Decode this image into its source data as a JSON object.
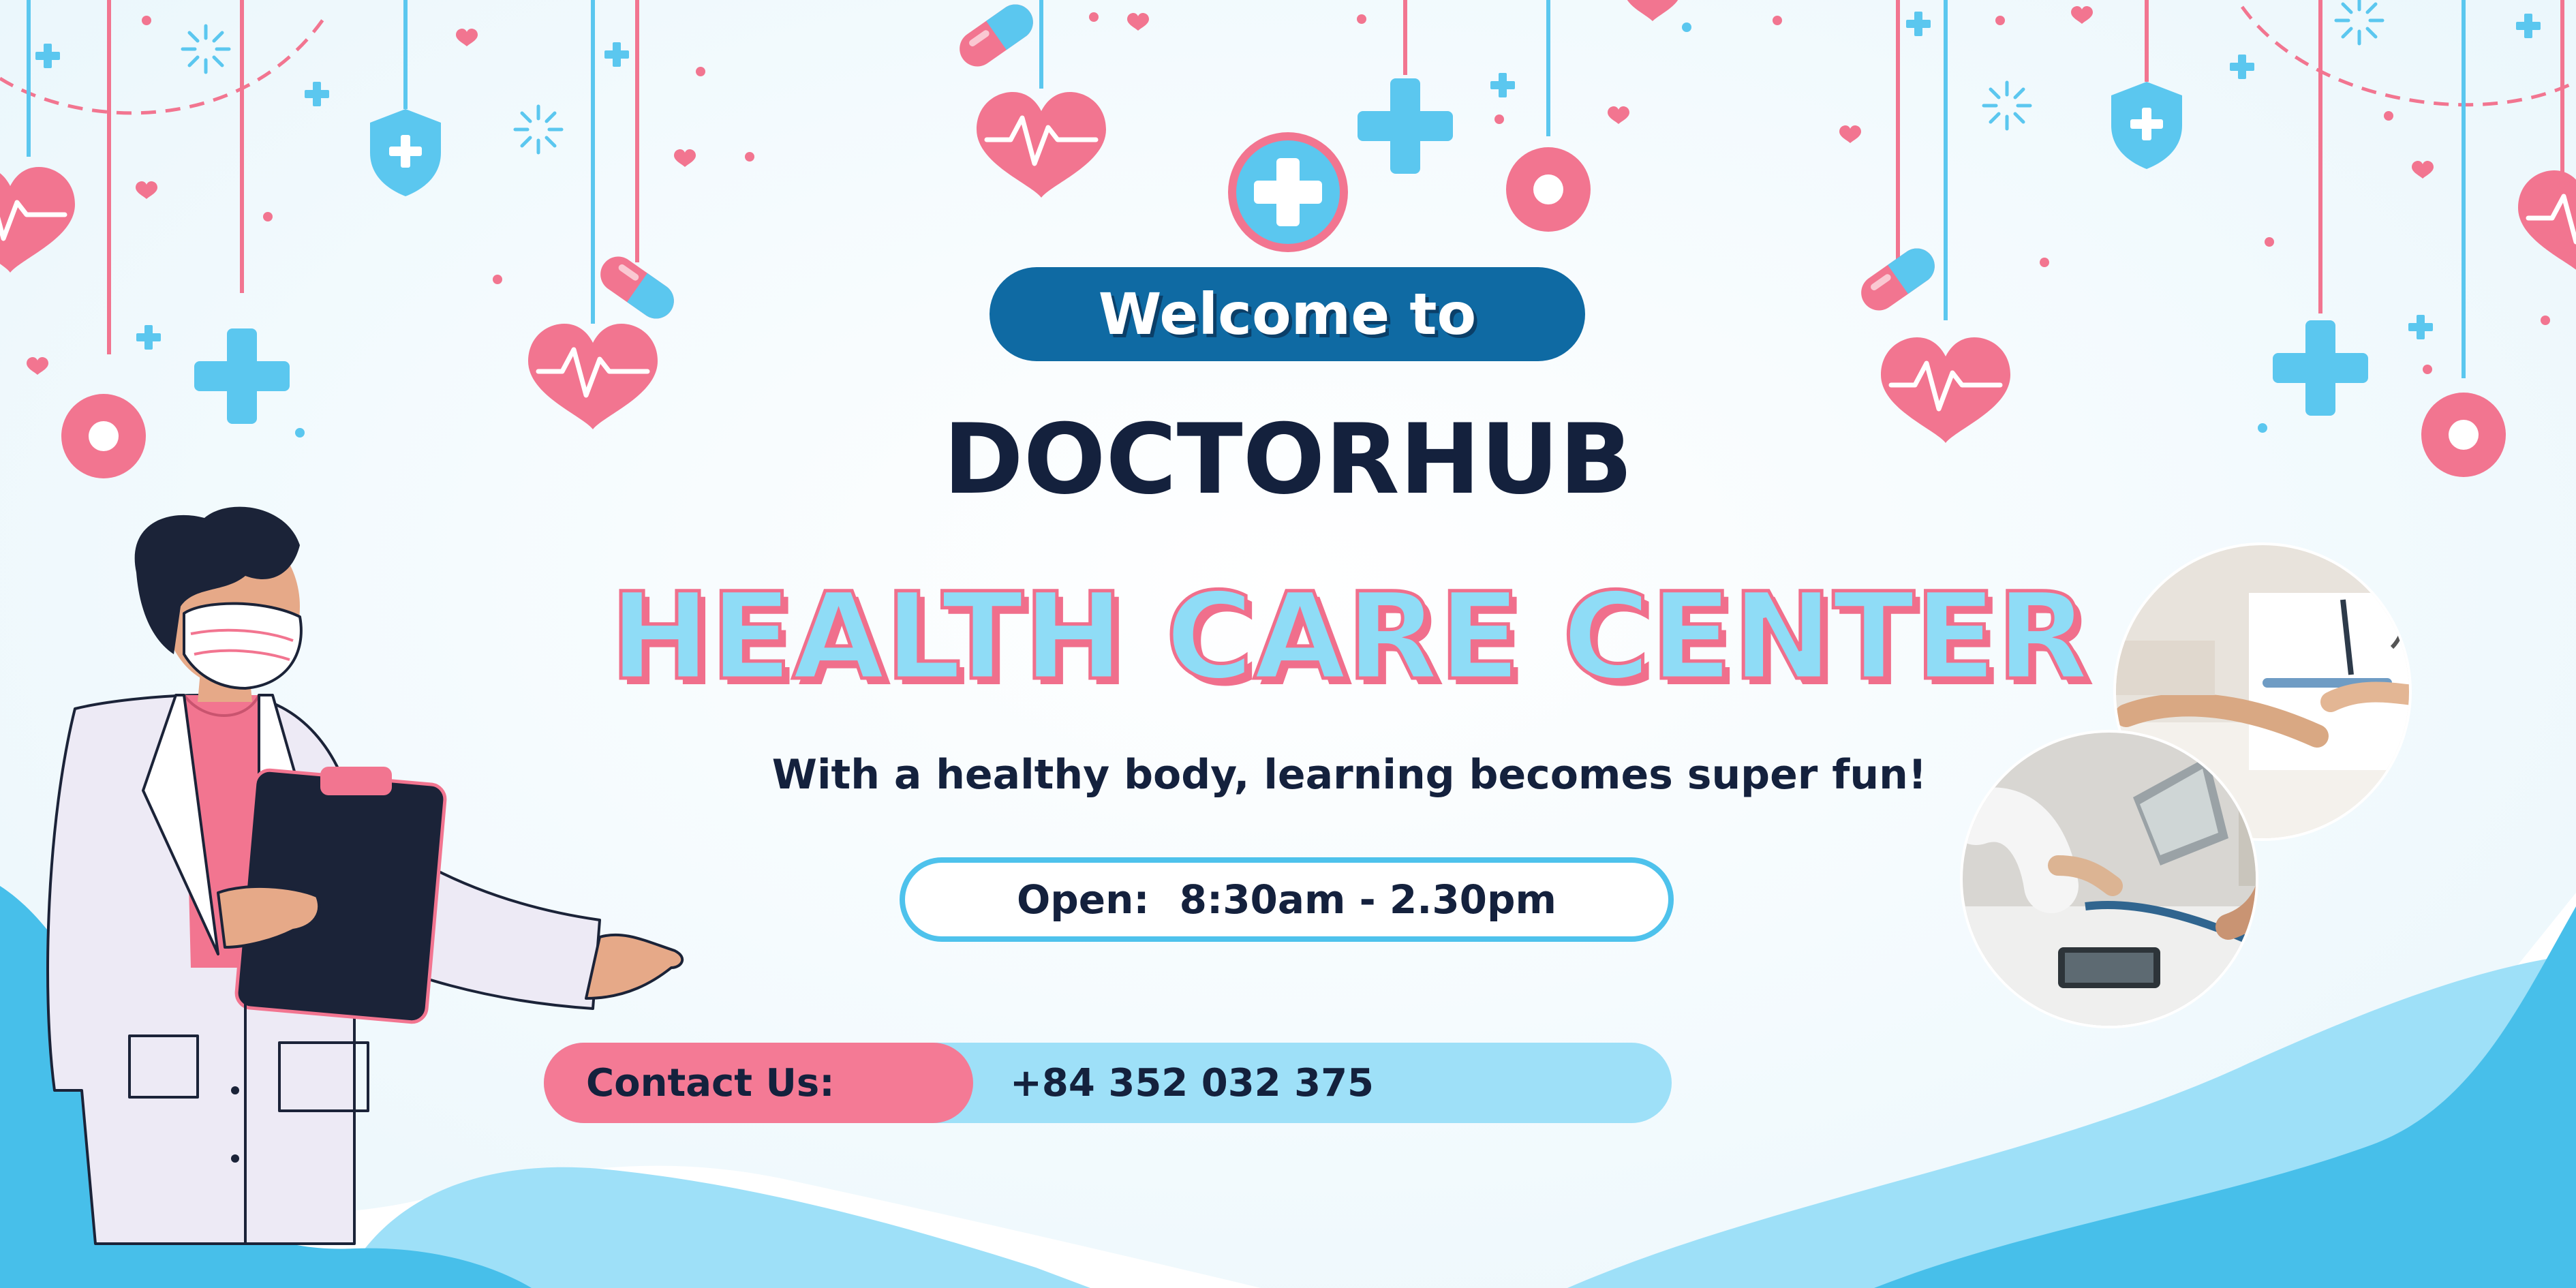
{
  "banner": {
    "welcome": "Welcome to",
    "brand": "DOCTORHUB",
    "headline": "HEALTH CARE CENTER",
    "tagline": "With a healthy body, learning becomes super fun!",
    "hours_label": "Open:",
    "hours_value": "8:30am - 2.30pm",
    "contact_label": "Contact Us:",
    "contact_phone": "+84 352 032 375"
  },
  "icons": [
    "heart-ornament-icon",
    "medical-cross-icon",
    "pill-capsule-icon",
    "ring-ornament-icon",
    "shield-cross-icon",
    "sparkle-icon",
    "doctor-illustration",
    "clinic-photo-icon"
  ],
  "colors": {
    "navy": "#14213d",
    "blue_pill": "#0f6aa3",
    "light_blue": "#8fdcf6",
    "sky": "#4ec2ec",
    "pink": "#f06f8c",
    "contact_pink": "#f47a95"
  }
}
